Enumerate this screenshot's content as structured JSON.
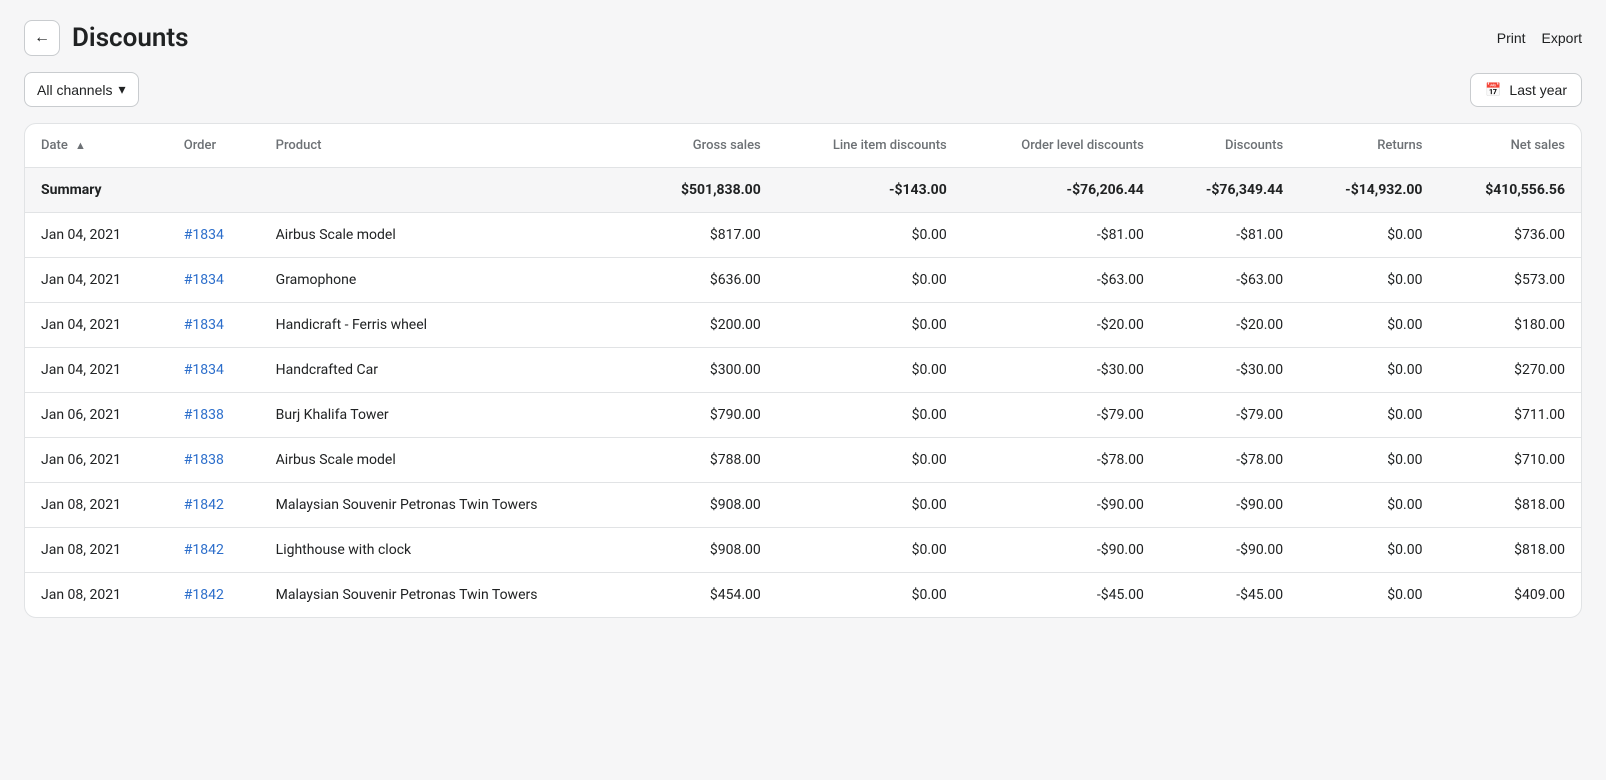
{
  "header": {
    "back_label": "←",
    "title": "Discounts",
    "actions": [
      {
        "id": "print",
        "label": "Print"
      },
      {
        "id": "export",
        "label": "Export"
      }
    ]
  },
  "filters": {
    "channel_label": "All channels",
    "channel_chevron": "▾",
    "date_icon": "📅",
    "date_range_label": "Last year"
  },
  "table": {
    "columns": [
      {
        "id": "date",
        "label": "Date",
        "sort": "▲",
        "numeric": false
      },
      {
        "id": "order",
        "label": "Order",
        "numeric": false
      },
      {
        "id": "product",
        "label": "Product",
        "numeric": false
      },
      {
        "id": "gross_sales",
        "label": "Gross sales",
        "numeric": true
      },
      {
        "id": "line_item_discounts",
        "label": "Line item discounts",
        "numeric": true
      },
      {
        "id": "order_level_discounts",
        "label": "Order level discounts",
        "numeric": true
      },
      {
        "id": "discounts",
        "label": "Discounts",
        "numeric": true
      },
      {
        "id": "returns",
        "label": "Returns",
        "numeric": true
      },
      {
        "id": "net_sales",
        "label": "Net sales",
        "numeric": true
      }
    ],
    "summary": {
      "label": "Summary",
      "gross_sales": "$501,838.00",
      "line_item_discounts": "-$143.00",
      "order_level_discounts": "-$76,206.44",
      "discounts": "-$76,349.44",
      "returns": "-$14,932.00",
      "net_sales": "$410,556.56"
    },
    "rows": [
      {
        "date": "Jan 04, 2021",
        "order": "#1834",
        "product": "Airbus Scale model",
        "gross_sales": "$817.00",
        "line_item_discounts": "$0.00",
        "order_level_discounts": "-$81.00",
        "discounts": "-$81.00",
        "returns": "$0.00",
        "net_sales": "$736.00"
      },
      {
        "date": "Jan 04, 2021",
        "order": "#1834",
        "product": "Gramophone",
        "gross_sales": "$636.00",
        "line_item_discounts": "$0.00",
        "order_level_discounts": "-$63.00",
        "discounts": "-$63.00",
        "returns": "$0.00",
        "net_sales": "$573.00"
      },
      {
        "date": "Jan 04, 2021",
        "order": "#1834",
        "product": "Handicraft - Ferris wheel",
        "gross_sales": "$200.00",
        "line_item_discounts": "$0.00",
        "order_level_discounts": "-$20.00",
        "discounts": "-$20.00",
        "returns": "$0.00",
        "net_sales": "$180.00"
      },
      {
        "date": "Jan 04, 2021",
        "order": "#1834",
        "product": "Handcrafted Car",
        "gross_sales": "$300.00",
        "line_item_discounts": "$0.00",
        "order_level_discounts": "-$30.00",
        "discounts": "-$30.00",
        "returns": "$0.00",
        "net_sales": "$270.00"
      },
      {
        "date": "Jan 06, 2021",
        "order": "#1838",
        "product": "Burj Khalifa Tower",
        "gross_sales": "$790.00",
        "line_item_discounts": "$0.00",
        "order_level_discounts": "-$79.00",
        "discounts": "-$79.00",
        "returns": "$0.00",
        "net_sales": "$711.00"
      },
      {
        "date": "Jan 06, 2021",
        "order": "#1838",
        "product": "Airbus Scale model",
        "gross_sales": "$788.00",
        "line_item_discounts": "$0.00",
        "order_level_discounts": "-$78.00",
        "discounts": "-$78.00",
        "returns": "$0.00",
        "net_sales": "$710.00"
      },
      {
        "date": "Jan 08, 2021",
        "order": "#1842",
        "product": "Malaysian Souvenir Petronas Twin Towers",
        "gross_sales": "$908.00",
        "line_item_discounts": "$0.00",
        "order_level_discounts": "-$90.00",
        "discounts": "-$90.00",
        "returns": "$0.00",
        "net_sales": "$818.00"
      },
      {
        "date": "Jan 08, 2021",
        "order": "#1842",
        "product": "Lighthouse with clock",
        "gross_sales": "$908.00",
        "line_item_discounts": "$0.00",
        "order_level_discounts": "-$90.00",
        "discounts": "-$90.00",
        "returns": "$0.00",
        "net_sales": "$818.00"
      },
      {
        "date": "Jan 08, 2021",
        "order": "#1842",
        "product": "Malaysian Souvenir Petronas Twin Towers",
        "gross_sales": "$454.00",
        "line_item_discounts": "$0.00",
        "order_level_discounts": "-$45.00",
        "discounts": "-$45.00",
        "returns": "$0.00",
        "net_sales": "$409.00"
      }
    ]
  }
}
